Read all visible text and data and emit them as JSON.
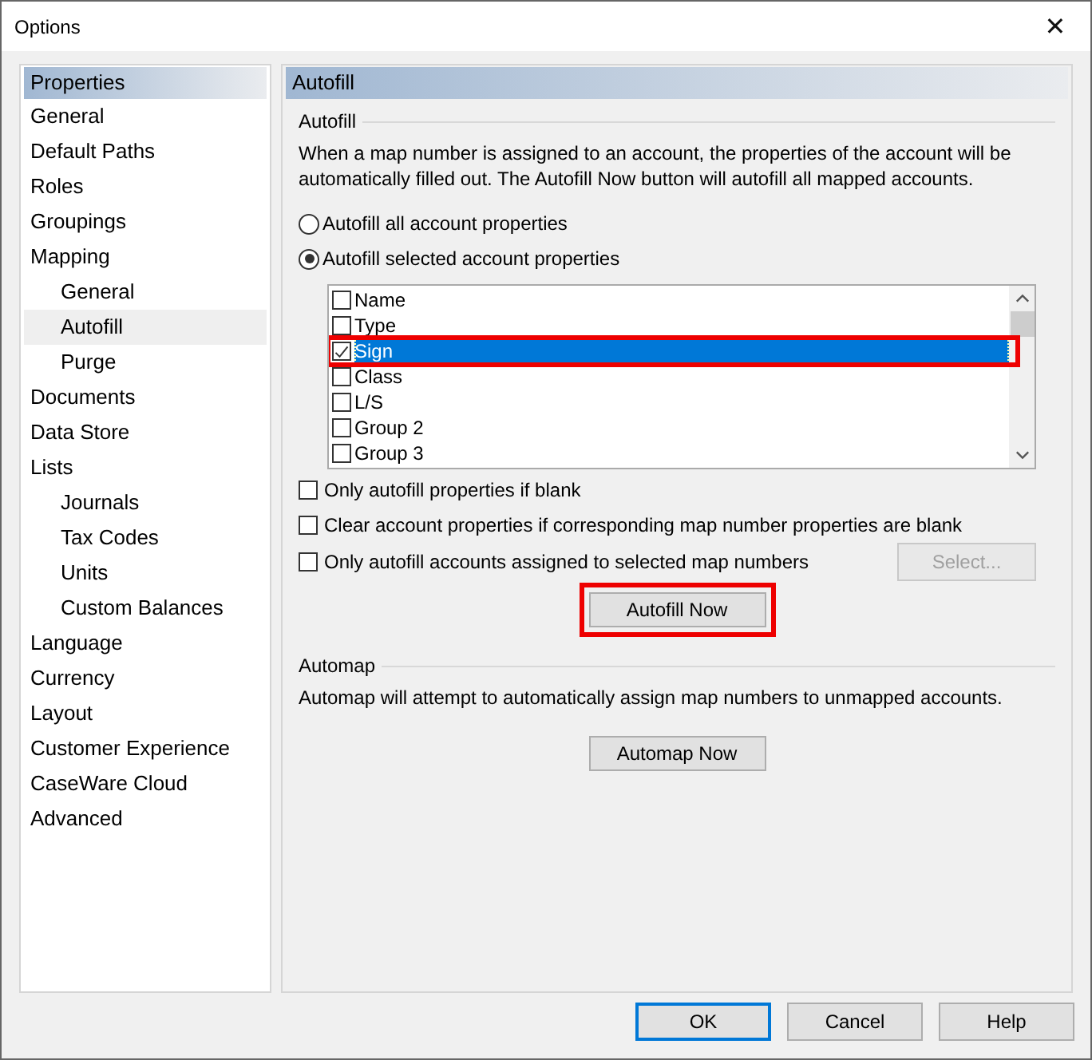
{
  "window": {
    "title": "Options",
    "close": "✕"
  },
  "sidebar": {
    "header": "Properties",
    "items": [
      {
        "label": "General",
        "selected": false
      },
      {
        "label": "Default Paths",
        "selected": false
      },
      {
        "label": "Roles",
        "selected": false
      },
      {
        "label": "Groupings",
        "selected": false
      },
      {
        "label": "Mapping",
        "selected": false,
        "children": [
          {
            "label": "General",
            "selected": false
          },
          {
            "label": "Autofill",
            "selected": true
          },
          {
            "label": "Purge",
            "selected": false
          }
        ]
      },
      {
        "label": "Documents",
        "selected": false
      },
      {
        "label": "Data Store",
        "selected": false
      },
      {
        "label": "Lists",
        "selected": false,
        "children": [
          {
            "label": "Journals",
            "selected": false
          },
          {
            "label": "Tax Codes",
            "selected": false
          },
          {
            "label": "Units",
            "selected": false
          },
          {
            "label": "Custom Balances",
            "selected": false
          }
        ]
      },
      {
        "label": "Language",
        "selected": false
      },
      {
        "label": "Currency",
        "selected": false
      },
      {
        "label": "Layout",
        "selected": false
      },
      {
        "label": "Customer Experience",
        "selected": false
      },
      {
        "label": "CaseWare Cloud",
        "selected": false
      },
      {
        "label": "Advanced",
        "selected": false
      }
    ]
  },
  "panel": {
    "header": "Autofill",
    "autofill": {
      "title": "Autofill",
      "description": "When a map number is assigned to an account, the properties of the account will be automatically filled out. The Autofill Now button will autofill all mapped accounts.",
      "radios": [
        {
          "label": "Autofill all account properties",
          "selected": false
        },
        {
          "label": "Autofill selected account properties",
          "selected": true
        }
      ],
      "properties": [
        {
          "label": "Name",
          "checked": false,
          "selected": false,
          "highlighted": false
        },
        {
          "label": "Type",
          "checked": false,
          "selected": false,
          "highlighted": false
        },
        {
          "label": "Sign",
          "checked": true,
          "selected": true,
          "highlighted": true
        },
        {
          "label": "Class",
          "checked": false,
          "selected": false,
          "highlighted": false
        },
        {
          "label": "L/S",
          "checked": false,
          "selected": false,
          "highlighted": false
        },
        {
          "label": "Group 2",
          "checked": false,
          "selected": false,
          "highlighted": false
        },
        {
          "label": "Group 3",
          "checked": false,
          "selected": false,
          "highlighted": false
        }
      ],
      "options": [
        {
          "label": "Only autofill properties if blank",
          "checked": false
        },
        {
          "label": "Clear account properties if corresponding map number properties are blank",
          "checked": false
        },
        {
          "label": "Only autofill accounts assigned to selected map numbers",
          "checked": false
        }
      ],
      "select_button": {
        "label": "Select...",
        "disabled": true
      },
      "action_button": {
        "label": "Autofill Now",
        "highlighted": true
      }
    },
    "automap": {
      "title": "Automap",
      "description": "Automap will attempt to automatically assign map numbers to unmapped accounts.",
      "action_button": {
        "label": "Automap Now",
        "highlighted": false
      }
    }
  },
  "buttons": [
    {
      "label": "OK",
      "default": true
    },
    {
      "label": "Cancel",
      "default": false
    },
    {
      "label": "Help",
      "default": false
    }
  ]
}
